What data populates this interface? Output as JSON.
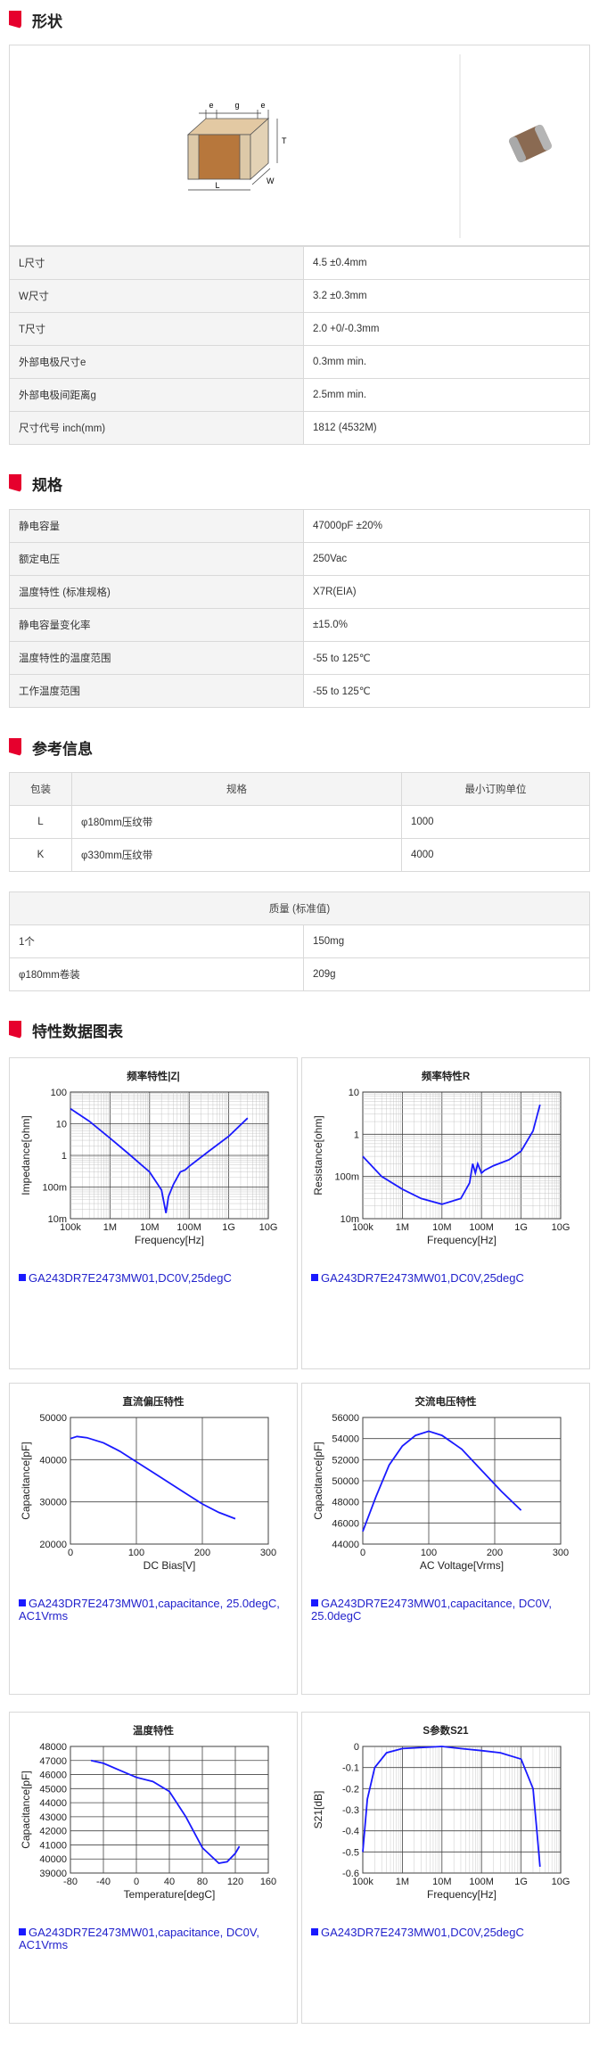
{
  "sections": {
    "shape": "形状",
    "spec": "规格",
    "ref": "参考信息",
    "chart": "特性数据图表"
  },
  "dim_labels": {
    "e": "e",
    "g": "g",
    "T": "T",
    "W": "W",
    "L": "L"
  },
  "shape_rows": [
    {
      "k": "L尺寸",
      "v": "4.5 ±0.4mm"
    },
    {
      "k": "W尺寸",
      "v": "3.2 ±0.3mm"
    },
    {
      "k": "T尺寸",
      "v": "2.0 +0/-0.3mm"
    },
    {
      "k": "外部电极尺寸e",
      "v": "0.3mm min."
    },
    {
      "k": "外部电极间距离g",
      "v": "2.5mm min."
    },
    {
      "k": "尺寸代号 inch(mm)",
      "v": "1812 (4532M)"
    }
  ],
  "spec_rows": [
    {
      "k": "静电容量",
      "v": "47000pF ±20%"
    },
    {
      "k": "额定电压",
      "v": "250Vac"
    },
    {
      "k": "温度特性 (标准规格)",
      "v": "X7R(EIA)"
    },
    {
      "k": "静电容量变化率",
      "v": "±15.0%"
    },
    {
      "k": "温度特性的温度范围",
      "v": "-55 to 125℃"
    },
    {
      "k": "工作温度范围",
      "v": "-55 to 125℃"
    }
  ],
  "pack": {
    "headers": [
      "包装",
      "规格",
      "最小订购单位"
    ],
    "rows": [
      {
        "c": "L",
        "s": "φ180mm压纹带",
        "q": "1000"
      },
      {
        "c": "K",
        "s": "φ330mm压纹带",
        "q": "4000"
      }
    ]
  },
  "mass": {
    "header": "质量 (标准值)",
    "rows": [
      {
        "k": "1个",
        "v": "150mg"
      },
      {
        "k": "φ180mm卷装",
        "v": "209g"
      }
    ]
  },
  "colors": {
    "curve": "#1a1aff",
    "flag": "#e6002d"
  },
  "charts": [
    {
      "type": "line",
      "title": "频率特性|Z|",
      "xlabel": "Frequency[Hz]",
      "ylabel": "Impedance[ohm]",
      "xscale": "log",
      "yscale": "log",
      "xticks": [
        "100k",
        "1M",
        "10M",
        "100M",
        "1G",
        "10G"
      ],
      "yticks": [
        "100",
        "10",
        "1",
        "100m",
        "10m"
      ],
      "legend": "GA243DR7E2473MW01,DC0V,25degC",
      "x": [
        100000.0,
        300000.0,
        1000000.0,
        3000000.0,
        10000000.0,
        20000000.0,
        26000000.0,
        30000000.0,
        40000000.0,
        50000000.0,
        60000000.0,
        80000000.0,
        100000000.0,
        300000000.0,
        1000000000.0,
        3000000000.0
      ],
      "y": [
        30,
        12,
        3.5,
        1.1,
        0.3,
        0.08,
        0.015,
        0.05,
        0.12,
        0.2,
        0.3,
        0.35,
        0.45,
        1.3,
        4,
        15
      ]
    },
    {
      "type": "line",
      "title": "频率特性R",
      "xlabel": "Frequency[Hz]",
      "ylabel": "Resistance[ohm]",
      "xscale": "log",
      "yscale": "log",
      "xticks": [
        "100k",
        "1M",
        "10M",
        "100M",
        "1G",
        "10G"
      ],
      "yticks": [
        "10",
        "1",
        "100m",
        "10m"
      ],
      "legend": "GA243DR7E2473MW01,DC0V,25degC",
      "x": [
        100000.0,
        300000.0,
        1000000.0,
        3000000.0,
        10000000.0,
        30000000.0,
        50000000.0,
        60000000.0,
        70000000.0,
        80000000.0,
        100000000.0,
        120000000.0,
        200000000.0,
        500000000.0,
        1000000000.0,
        2000000000.0,
        3000000000.0
      ],
      "y": [
        0.3,
        0.1,
        0.05,
        0.03,
        0.022,
        0.03,
        0.07,
        0.2,
        0.12,
        0.2,
        0.12,
        0.14,
        0.18,
        0.25,
        0.4,
        1.2,
        5
      ]
    },
    {
      "type": "line",
      "title": "直流偏压特性",
      "xlabel": "DC Bias[V]",
      "ylabel": "Capacitance[pF]",
      "xticks": [
        "0",
        "100",
        "200",
        "300"
      ],
      "yticks": [
        "50000",
        "40000",
        "30000",
        "20000"
      ],
      "xlim": [
        0,
        300
      ],
      "ylim": [
        20000,
        50000
      ],
      "legend": "GA243DR7E2473MW01,capacitance, 25.0degC, AC1Vrms",
      "x": [
        0,
        10,
        25,
        50,
        75,
        100,
        125,
        150,
        175,
        200,
        225,
        250
      ],
      "y": [
        45000,
        45500,
        45200,
        44000,
        42000,
        39500,
        37000,
        34500,
        32000,
        29500,
        27500,
        26000
      ]
    },
    {
      "type": "line",
      "title": "交流电压特性",
      "xlabel": "AC Voltage[Vrms]",
      "ylabel": "Capacitance[pF]",
      "xticks": [
        "0",
        "100",
        "200",
        "300"
      ],
      "yticks": [
        "56000",
        "54000",
        "52000",
        "50000",
        "48000",
        "46000",
        "44000"
      ],
      "xlim": [
        0,
        300
      ],
      "ylim": [
        44000,
        56000
      ],
      "legend": "GA243DR7E2473MW01,capacitance, DC0V, 25.0degC",
      "x": [
        0,
        20,
        40,
        60,
        80,
        100,
        120,
        150,
        180,
        210,
        240
      ],
      "y": [
        45200,
        48500,
        51500,
        53300,
        54300,
        54700,
        54300,
        53000,
        51000,
        49000,
        47200
      ]
    },
    {
      "type": "line",
      "title": "温度特性",
      "xlabel": "Temperature[degC]",
      "ylabel": "Capacitance[pF]",
      "xticks": [
        "-80",
        "-40",
        "0",
        "40",
        "80",
        "120",
        "160"
      ],
      "yticks": [
        "48000",
        "47000",
        "46000",
        "45000",
        "44000",
        "43000",
        "42000",
        "41000",
        "40000",
        "39000"
      ],
      "xlim": [
        -80,
        160
      ],
      "ylim": [
        39000,
        48000
      ],
      "legend": "GA243DR7E2473MW01,capacitance, DC0V, AC1Vrms",
      "x": [
        -55,
        -40,
        -20,
        0,
        20,
        40,
        60,
        80,
        100,
        110,
        120,
        125
      ],
      "y": [
        47000,
        46800,
        46300,
        45800,
        45500,
        44800,
        43000,
        40800,
        39700,
        39800,
        40400,
        40900
      ]
    },
    {
      "type": "line",
      "title": "S参数S21",
      "xlabel": "Frequency[Hz]",
      "ylabel": "S21[dB]",
      "xscale": "log",
      "xticks": [
        "100k",
        "1M",
        "10M",
        "100M",
        "1G",
        "10G"
      ],
      "yticks": [
        "0",
        "-0.1",
        "-0.2",
        "-0.3",
        "-0.4",
        "-0.5",
        "-0.6"
      ],
      "ylim": [
        -0.6,
        0
      ],
      "legend": "GA243DR7E2473MW01,DC0V,25degC",
      "x": [
        100000.0,
        130000.0,
        200000.0,
        400000.0,
        1000000.0,
        10000000.0,
        30000000.0,
        100000000.0,
        300000000.0,
        1000000000.0,
        2000000000.0,
        2500000000.0,
        3000000000.0
      ],
      "y": [
        -0.5,
        -0.25,
        -0.1,
        -0.03,
        -0.01,
        0,
        -0.01,
        -0.02,
        -0.03,
        -0.06,
        -0.2,
        -0.4,
        -0.57
      ]
    }
  ]
}
